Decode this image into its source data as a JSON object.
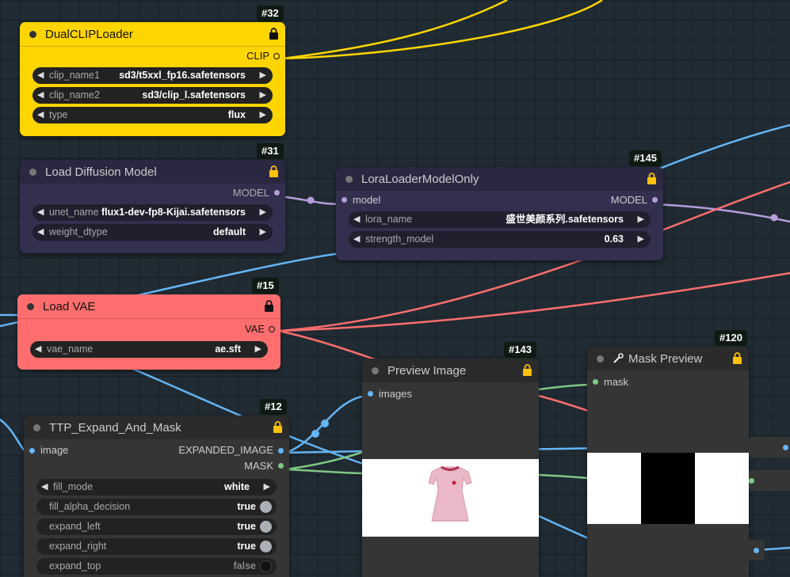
{
  "nodes": {
    "dualclip": {
      "id": "#32",
      "title": "DualCLIPLoader",
      "output": "CLIP",
      "widgets": [
        {
          "name": "clip_name1",
          "value": "sd3/t5xxl_fp16.safetensors"
        },
        {
          "name": "clip_name2",
          "value": "sd3/clip_l.safetensors"
        },
        {
          "name": "type",
          "value": "flux"
        }
      ]
    },
    "diffusion": {
      "id": "#31",
      "title": "Load Diffusion Model",
      "output": "MODEL",
      "widgets": [
        {
          "name": "unet_name",
          "value": "flux1-dev-fp8-Kijai.safetensors"
        },
        {
          "name": "weight_dtype",
          "value": "default"
        }
      ]
    },
    "lora": {
      "id": "#145",
      "title": "LoraLoaderModelOnly",
      "input": "model",
      "output": "MODEL",
      "widgets": [
        {
          "name": "lora_name",
          "value": "盛世美颜系列.safetensors"
        },
        {
          "name": "strength_model",
          "value": "0.63"
        }
      ]
    },
    "vae": {
      "id": "#15",
      "title": "Load VAE",
      "output": "VAE",
      "widgets": [
        {
          "name": "vae_name",
          "value": "ae.sft"
        }
      ]
    },
    "preview": {
      "id": "#143",
      "title": "Preview Image",
      "input": "images"
    },
    "mask_preview": {
      "id": "#120",
      "title": "Mask Preview",
      "input": "mask"
    },
    "ttp": {
      "id": "#12",
      "title": "TTP_Expand_And_Mask",
      "input": "image",
      "outputs": [
        "EXPANDED_IMAGE",
        "MASK"
      ],
      "widgets": [
        {
          "name": "fill_mode",
          "value": "white"
        }
      ],
      "toggles": [
        {
          "name": "fill_alpha_decision",
          "value": "true"
        },
        {
          "name": "expand_left",
          "value": "true"
        },
        {
          "name": "expand_right",
          "value": "true"
        },
        {
          "name": "expand_top",
          "value": "false"
        }
      ]
    }
  },
  "colors": {
    "clip_wire": "#ffd500",
    "model_wire": "#b39ddb",
    "vae_wire": "#ff6e6e",
    "image_wire": "#64b5f6",
    "mask_wire": "#81c784",
    "dualclip_node": "#ffd500",
    "diffusion_node": "#332f4f",
    "vae_node": "#ff6e6e",
    "default_node": "#353535"
  },
  "icons": {
    "lock": "lock-icon",
    "mask_preview": "wrench-icon"
  }
}
